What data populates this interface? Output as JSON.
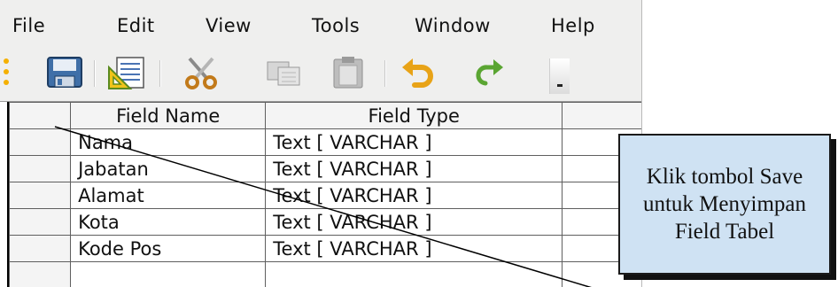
{
  "menubar": {
    "items": [
      {
        "label": "File"
      },
      {
        "label": "Edit"
      },
      {
        "label": "View"
      },
      {
        "label": "Tools"
      },
      {
        "label": "Window"
      },
      {
        "label": "Help"
      }
    ]
  },
  "toolbar": {
    "buttons": [
      {
        "icon": "save-icon"
      },
      {
        "icon": "table-design-icon"
      },
      {
        "icon": "cut-icon"
      },
      {
        "icon": "copy-icon"
      },
      {
        "icon": "paste-icon"
      },
      {
        "icon": "undo-icon"
      },
      {
        "icon": "redo-icon"
      }
    ],
    "grip_color": "#f5b000"
  },
  "grid": {
    "headers": {
      "field_name": "Field Name",
      "field_type": "Field Type"
    },
    "rows": [
      {
        "name": "Nama",
        "type": "Text [ VARCHAR ]"
      },
      {
        "name": "Jabatan",
        "type": "Text [ VARCHAR ]"
      },
      {
        "name": "Alamat",
        "type": "Text [ VARCHAR ]"
      },
      {
        "name": "Kota",
        "type": "Text [ VARCHAR ]"
      },
      {
        "name": "Kode Pos",
        "type": "Text [ VARCHAR ]"
      },
      {
        "name": "",
        "type": ""
      }
    ]
  },
  "callout": {
    "text": "Klik tombol Save untuk Menyimpan Field Tabel",
    "background": "#cfe2f3"
  }
}
